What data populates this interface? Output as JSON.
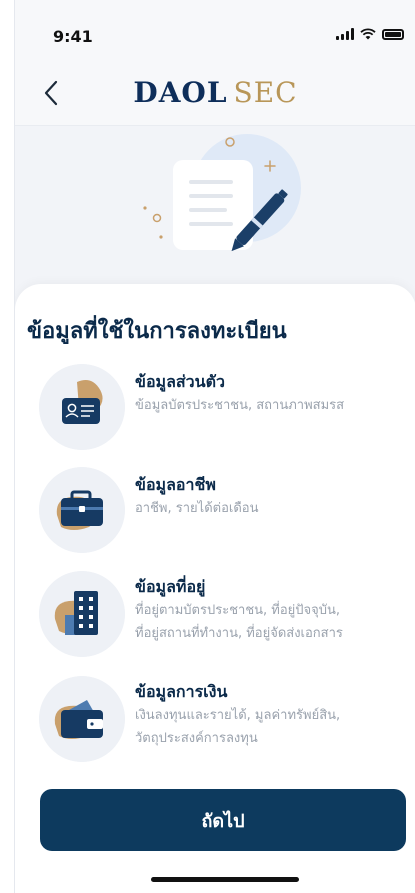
{
  "status_bar": {
    "time": "9:41"
  },
  "header": {
    "brand_part1": "DAOL",
    "brand_part2": "SEC"
  },
  "content": {
    "title": "ข้อมูลที่ใช้ในการลงทะเบียน",
    "items": [
      {
        "title": "ข้อมูลส่วนตัว",
        "desc_lines": [
          "ข้อมูลบัตรประชาชน, สถานภาพสมรส"
        ],
        "icon": "id-card-icon"
      },
      {
        "title": "ข้อมูลอาชีพ",
        "desc_lines": [
          "อาชีพ, รายได้ต่อเดือน"
        ],
        "icon": "briefcase-icon"
      },
      {
        "title": "ข้อมูลที่อยู่",
        "desc_lines": [
          "ที่อยู่ตามบัตรประชาชน, ที่อยู่ปัจจุบัน,",
          "ที่อยู่สถานที่ทำงาน, ที่อยู่จัดส่งเอกสาร"
        ],
        "icon": "building-icon"
      },
      {
        "title": "ข้อมูลการเงิน",
        "desc_lines": [
          "เงินลงทุนและรายได้, มูลค่าทรัพย์สิน,",
          "วัตถุประสงค์การลงทุน"
        ],
        "icon": "wallet-icon"
      }
    ],
    "next_label": "ถัดไป"
  },
  "colors": {
    "primary": "#0d3a5e",
    "gold": "#b89658",
    "icon_blob": "#c9a06c"
  }
}
